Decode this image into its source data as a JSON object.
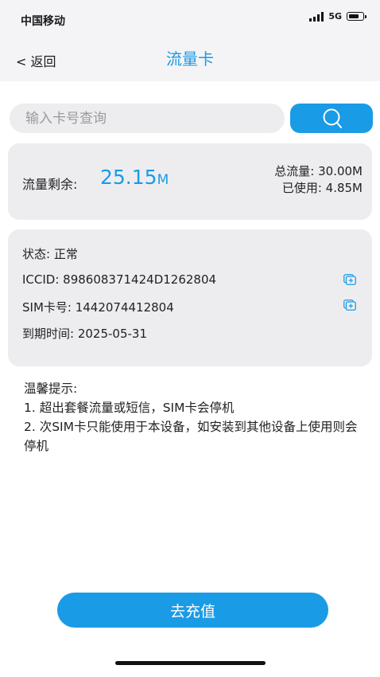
{
  "status_bar": {
    "carrier": "中国移动",
    "network": "5G",
    "icons": [
      "signal-icon",
      "battery-icon"
    ]
  },
  "nav": {
    "back_label": "< 返回",
    "title": "流量卡"
  },
  "search": {
    "placeholder": "输入卡号查询",
    "value": "",
    "button_icon": "search-icon"
  },
  "flow": {
    "remaining_label": "流量剩余:",
    "remaining_value": "25.15",
    "remaining_unit": "M",
    "total_line": "总流量: 30.00M",
    "used_line": "已使用: 4.85M"
  },
  "card_info": {
    "status": "状态: 正常",
    "iccid": "ICCID: 898608371424D1262804",
    "sim_no": "SIM卡号: 1442074412804",
    "expiry": "到期时间: 2025-05-31",
    "copy_icon": "copy-icon"
  },
  "tips": {
    "title": "温馨提示:",
    "items": [
      "1. 超出套餐流量或短信，SIM卡会停机",
      "2. 次SIM卡只能使用于本设备，如安装到其他设备上使用则会停机"
    ]
  },
  "actions": {
    "recharge_label": "去充值"
  },
  "colors": {
    "accent": "#1a9be6",
    "card_bg": "#ededf0",
    "header_bg": "#f4f4f6"
  }
}
